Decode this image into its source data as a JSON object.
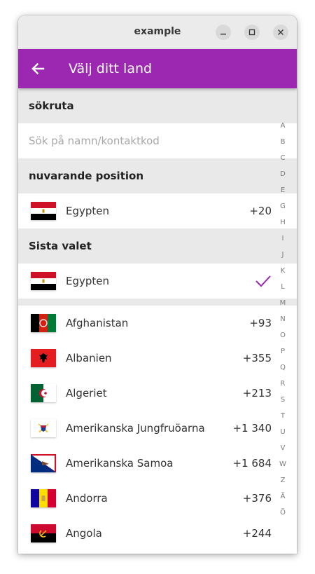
{
  "window": {
    "title": "example",
    "minimize_icon": "minimize-icon",
    "maximize_icon": "maximize-icon",
    "close_icon": "close-icon"
  },
  "appbar": {
    "title": "Välj ditt land",
    "back_icon": "arrow-back-icon",
    "color": "#9c27b0"
  },
  "sections": {
    "search": "sökruta",
    "current": "nuvarande position",
    "last": "Sista valet"
  },
  "search": {
    "placeholder": "Sök på namn/kontaktkod"
  },
  "current": {
    "name": "Egypten",
    "code": "+20"
  },
  "last": {
    "name": "Egypten",
    "check_icon": "check-icon"
  },
  "countries": [
    {
      "name": "Afghanistan",
      "code": "+93"
    },
    {
      "name": "Albanien",
      "code": "+355"
    },
    {
      "name": "Algeriet",
      "code": "+213"
    },
    {
      "name": "Amerikanska Jungfruöarna",
      "code": "+1 340"
    },
    {
      "name": "Amerikanska Samoa",
      "code": "+1 684"
    },
    {
      "name": "Andorra",
      "code": "+376"
    },
    {
      "name": "Angola",
      "code": "+244"
    }
  ],
  "index_letters": [
    "A",
    "B",
    "C",
    "D",
    "E",
    "G",
    "H",
    "I",
    "J",
    "K",
    "L",
    "M",
    "N",
    "O",
    "P",
    "Q",
    "R",
    "S",
    "T",
    "U",
    "V",
    "W",
    "Z",
    "Ä",
    "Ö"
  ]
}
